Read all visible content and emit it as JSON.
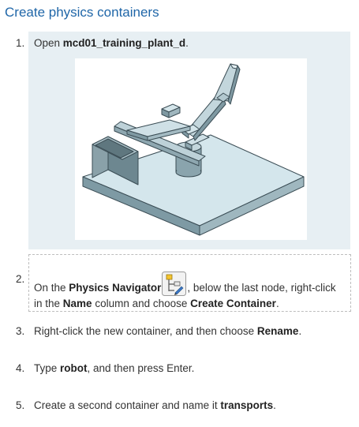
{
  "title": "Create physics containers",
  "steps": [
    {
      "num": "1.",
      "pre": "Open ",
      "bold": "mcd01_training_plant_d",
      "post": "."
    },
    {
      "num": "2.",
      "pre": "On the ",
      "bold1": "Physics Navigator",
      "mid1": ", below the last node, right-click in the ",
      "bold2": "Name",
      "mid2": " column and choose ",
      "bold3": "Create Container",
      "post": "."
    },
    {
      "num": "3.",
      "pre": "Right-click the new container, and then choose ",
      "bold": "Rename",
      "post": "."
    },
    {
      "num": "4.",
      "pre": "Type ",
      "bold": "robot",
      "post": ", and then press Enter."
    },
    {
      "num": "5.",
      "pre": "Create a second container and name it ",
      "bold": "transports",
      "post": "."
    }
  ],
  "icons": {
    "physics_navigator": "physics-navigator-icon"
  },
  "colors": {
    "title": "#1f66a8",
    "step_shade": "#e7eff3",
    "model_face": "#cfe3ea",
    "model_edge": "#3b4d55"
  }
}
